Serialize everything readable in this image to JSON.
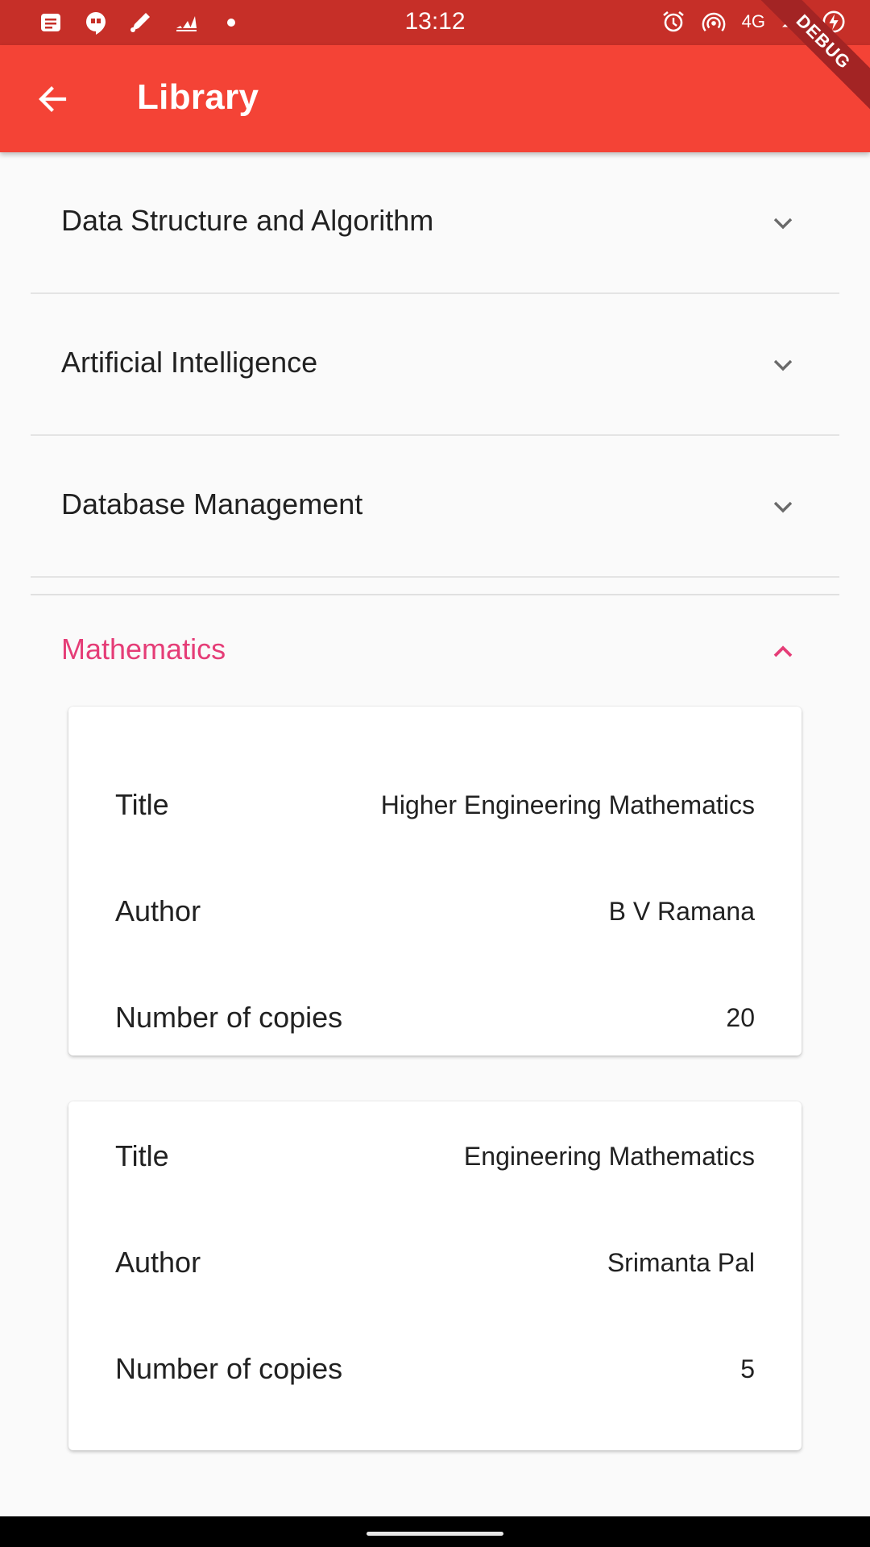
{
  "status_bar": {
    "time": "13:12",
    "network": "4G",
    "left_icons": [
      "message-icon",
      "hangouts-icon",
      "pen-icon",
      "adidas-icon",
      "dot-icon"
    ],
    "right_icons": [
      "alarm-icon",
      "hotspot-icon",
      "signal-icon",
      "battery-charging-icon"
    ]
  },
  "app_bar": {
    "title": "Library",
    "back_icon": "arrow-back-icon",
    "color": "#f44336",
    "debug_label": "DEBUG"
  },
  "panels": [
    {
      "title": "Data Structure and Algorithm",
      "expanded": false
    },
    {
      "title": "Artificial Intelligence",
      "expanded": false
    },
    {
      "title": "Database Management",
      "expanded": false
    }
  ],
  "expanded_panel": {
    "title": "Mathematics",
    "expanded": true,
    "accent_color": "#e53d77",
    "books": [
      {
        "title_label": "Title",
        "title": "Higher Engineering Mathematics",
        "author_label": "Author",
        "author": "B V Ramana",
        "copies_label": "Number of copies",
        "copies": "20"
      },
      {
        "title_label": "Title",
        "title": "Engineering Mathematics",
        "author_label": "Author",
        "author": "Srimanta Pal",
        "copies_label": "Number of copies",
        "copies": "5"
      }
    ]
  }
}
